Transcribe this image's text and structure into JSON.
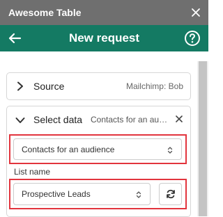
{
  "window": {
    "app_title": "Awesome Table",
    "close_icon": "close-icon"
  },
  "header": {
    "title": "New request",
    "back_icon": "arrow-left-icon",
    "help_icon": "help-circle-icon"
  },
  "source_section": {
    "label": "Source",
    "value": "Mailchimp: Bob",
    "icon": "chevron-right-icon"
  },
  "select_data_section": {
    "label": "Select data",
    "value": "Contacts for an audience",
    "icon": "chevron-down-icon",
    "clear_icon": "close-icon",
    "data_type_select": {
      "selected": "Contacts for an audience",
      "icon": "sort-arrows-icon"
    },
    "list_name": {
      "label": "List name",
      "selected": "Prospective Leads",
      "icon": "sort-arrows-icon",
      "refresh_icon": "refresh-icon"
    }
  },
  "colors": {
    "title_bar": "#6f6f6f",
    "header": "#147a63",
    "highlight": "#e2343d",
    "card_border": "#d6d6d6"
  }
}
